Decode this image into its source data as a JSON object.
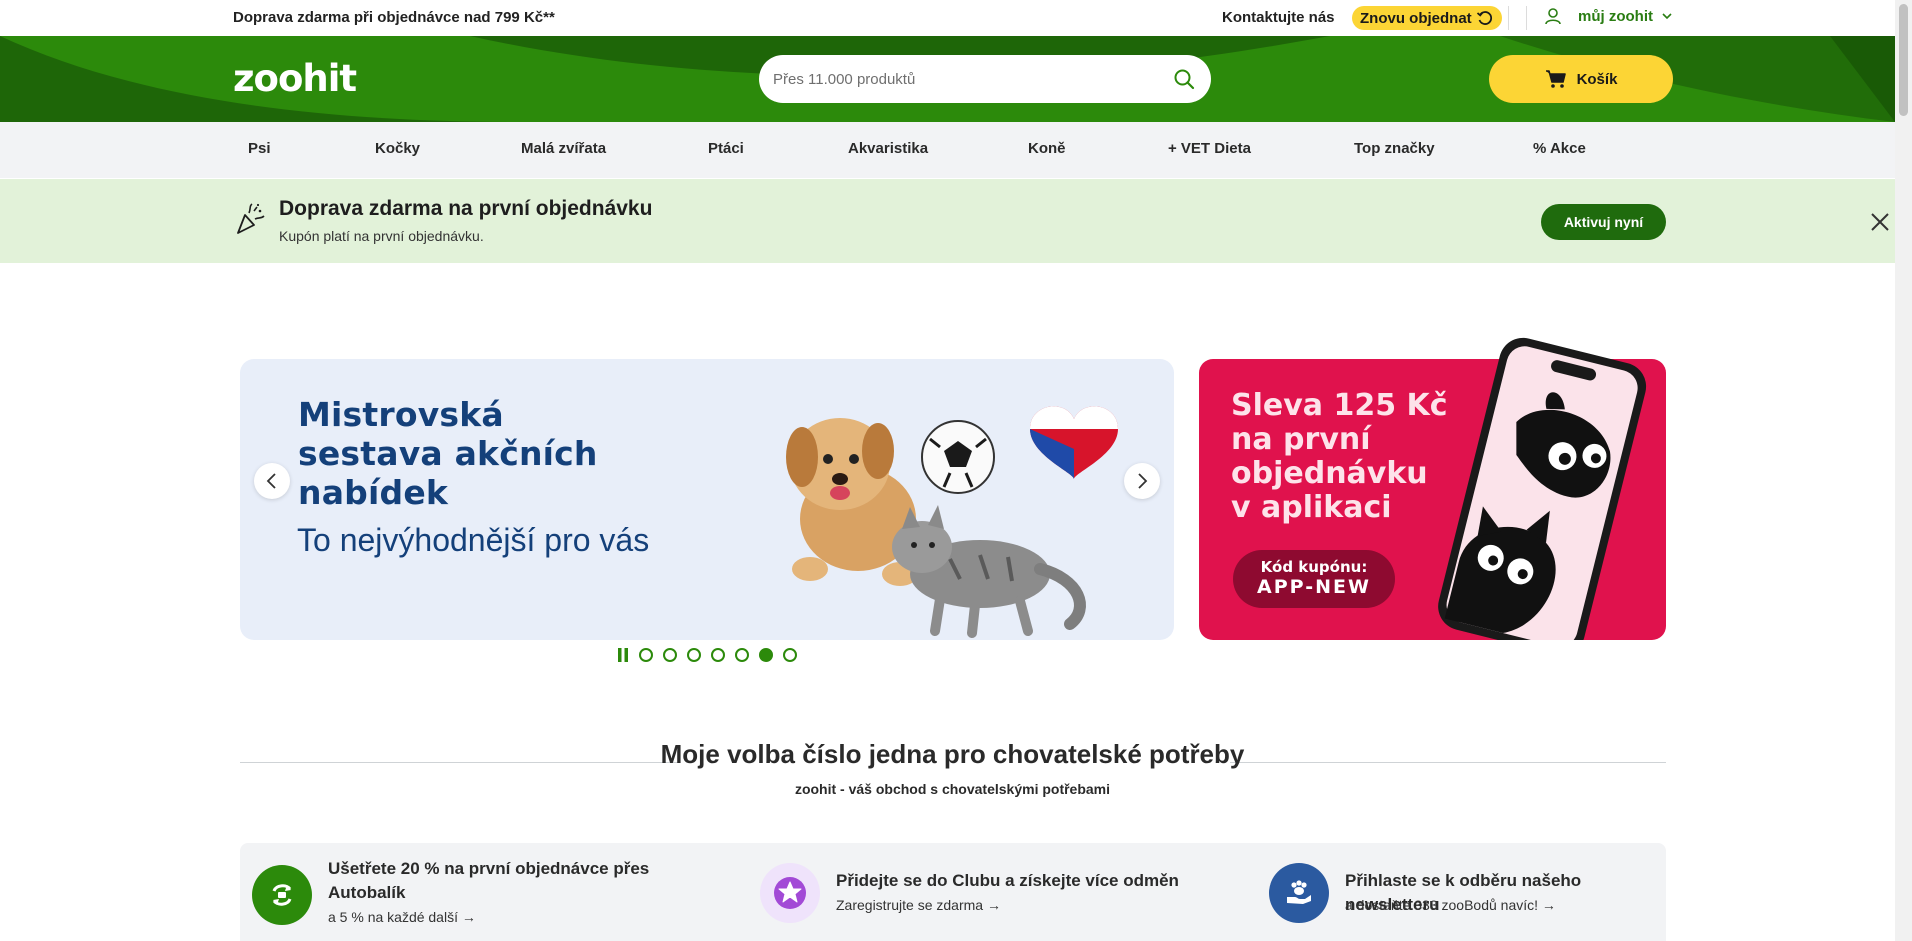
{
  "topbar": {
    "shipping_text": "Doprava zdarma při objednávce nad 799 Kč**",
    "contact_label": "Kontaktujte nás",
    "reorder_label": "Znovu objednat",
    "account_label": "můj zoohit"
  },
  "header": {
    "logo_text": "zoohit",
    "search_placeholder": "Přes 11.000 produktů",
    "cart_label": "Košík"
  },
  "nav": {
    "items": [
      "Psi",
      "Kočky",
      "Malá zvířata",
      "Ptáci",
      "Akvaristika",
      "Koně",
      "+ VET Dieta",
      "Top značky",
      "% Akce"
    ]
  },
  "promo": {
    "title": "Doprava zdarma na první objednávku",
    "subtitle": "Kupón platí na první objednávku.",
    "button_label": "Aktivuj nyní"
  },
  "carousel": {
    "main_banner": {
      "headline_line1": "Mistrovská",
      "headline_line2": "sestava akčních",
      "headline_line3": "nabídek",
      "subline": "To nejvýhodnější pro vás"
    },
    "side_banner": {
      "line1": "Sleva 125 Kč",
      "line2": "na první",
      "line3": "objednávku",
      "line4": "v aplikaci",
      "coupon_label": "Kód kupónu:",
      "coupon_code": "APP-NEW"
    },
    "slide_count": 7,
    "active_slide": 6
  },
  "section": {
    "title": "Moje volba číslo jedna pro chovatelské potřeby",
    "subtitle": "zoohit - váš obchod s chovatelskými potřebami"
  },
  "benefits": [
    {
      "title_line1": "Ušetřete 20 % na první objednávce přes",
      "title_line2": "Autobalík",
      "sub": "a 5 % na každé další →"
    },
    {
      "title_line1": "Přidejte se do Clubu a získejte více odměn",
      "sub": "Zaregistrujte se zdarma →"
    },
    {
      "title_line1": "Přihlaste se k odběru našeho newsletteru",
      "sub": "a dostaňte 333 zooBodů navíc! →"
    }
  ],
  "colors": {
    "brand_green": "#2c8a0b",
    "dark_green": "#1f6b0d",
    "accent_yellow": "#fcd535",
    "promo_bg": "#e2f2d9",
    "app_banner_red": "#e0124d"
  }
}
